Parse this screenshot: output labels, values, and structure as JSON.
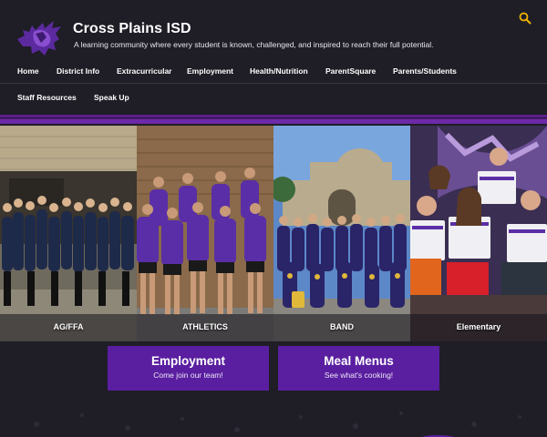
{
  "site": {
    "title": "Cross Plains ISD",
    "tagline": "A learning community where every student is known, challenged, and inspired to reach their full potential."
  },
  "nav": {
    "row1": [
      "Home",
      "District Info",
      "Extracurricular",
      "Employment",
      "Health/Nutrition",
      "ParentSquare",
      "Parents/Students"
    ],
    "row2": [
      "Staff Resources",
      "Speak Up"
    ]
  },
  "tiles": [
    {
      "label": "AG/FFA"
    },
    {
      "label": "ATHLETICS"
    },
    {
      "label": "BAND"
    },
    {
      "label": "Elementary"
    }
  ],
  "promos": [
    {
      "title": "Employment",
      "subtitle": "Come join our team!"
    },
    {
      "title": "Meal Menus",
      "subtitle": "See what's cooking!"
    }
  ],
  "icons": {
    "logo": "buffalo-logo-icon",
    "search": "search-icon"
  },
  "colors": {
    "background": "#1f1d26",
    "accent": "#5a1fa0",
    "search": "#f0b400"
  }
}
